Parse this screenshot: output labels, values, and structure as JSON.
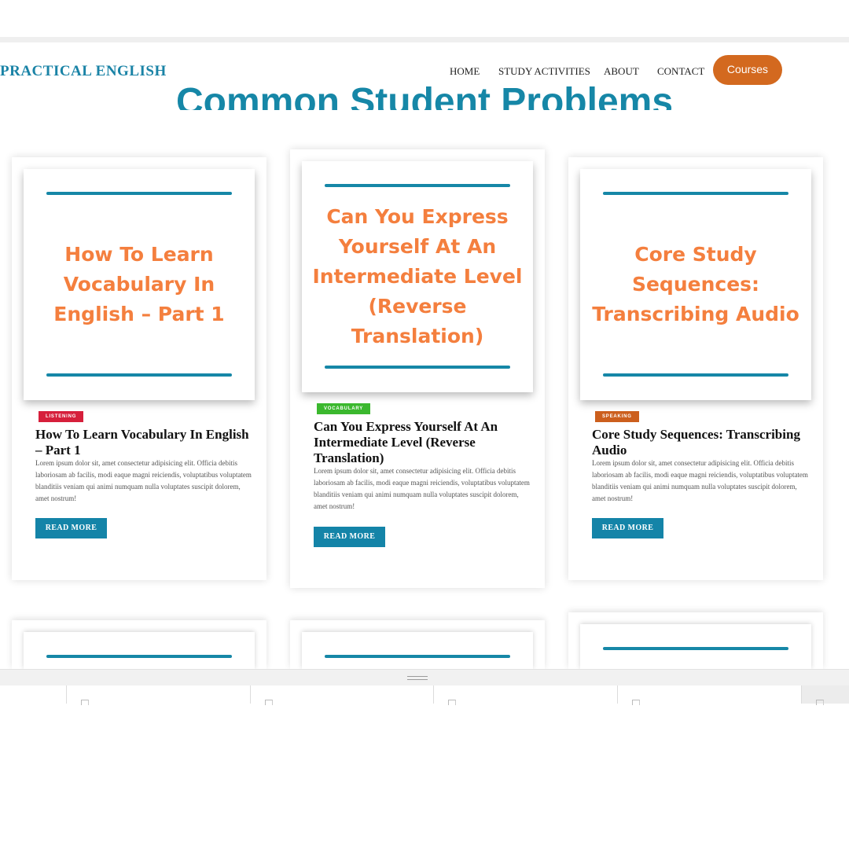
{
  "site": {
    "logo": "PRACTICAL ENGLISH",
    "nav": [
      "HOME",
      "STUDY ACTIVITIES",
      "ABOUT",
      "CONTACT"
    ],
    "courses_label": "Courses",
    "page_title": "Common Student Problems"
  },
  "colors": {
    "brand_blue": "#1687a7",
    "thumb_text_orange": "#f47f3e",
    "courses_orange": "#d3691f",
    "tag_listening": "#d61f3b",
    "tag_vocabulary": "#3bb82e",
    "tag_speaking": "#cc5f1d"
  },
  "posts": [
    {
      "thumb_title": "How To Learn Vocabulary In English – Part 1",
      "category": "LISTENING",
      "title": "How To Learn Vocabulary In English – Part 1",
      "excerpt": "Lorem ipsum dolor sit, amet consectetur adipisicing elit. Officia debitis laboriosam ab facilis, modi eaque magni reiciendis, voluptatibus voluptatem blanditiis veniam qui animi numquam nulla voluptates suscipit dolorem, amet nostrum!",
      "read_more": "READ MORE"
    },
    {
      "thumb_title": "Can You Express Yourself At An Intermediate Level (Reverse Translation)",
      "category": "VOCABULARY",
      "title": "Can You Express Yourself At An Intermediate Level (Reverse Translation)",
      "excerpt": "Lorem ipsum dolor sit, amet consectetur adipisicing elit. Officia debitis laboriosam ab facilis, modi eaque magni reiciendis, voluptatibus voluptatem blanditiis veniam qui animi numquam nulla voluptates suscipit dolorem, amet nostrum!",
      "read_more": "READ MORE"
    },
    {
      "thumb_title": "Core Study Sequences: Transcribing Audio",
      "category": "SPEAKING",
      "title": "Core Study Sequences: Transcribing Audio",
      "excerpt": "Lorem ipsum dolor sit, amet consectetur adipisicing elit. Officia debitis laboriosam ab facilis, modi eaque magni reiciendis, voluptatibus voluptatem blanditiis veniam qui animi numquam nulla voluptates suscipit dolorem, amet nostrum!",
      "read_more": "READ MORE"
    }
  ],
  "icons": {
    "splitter": "drag-handle-icon",
    "tab": "document-icon"
  }
}
